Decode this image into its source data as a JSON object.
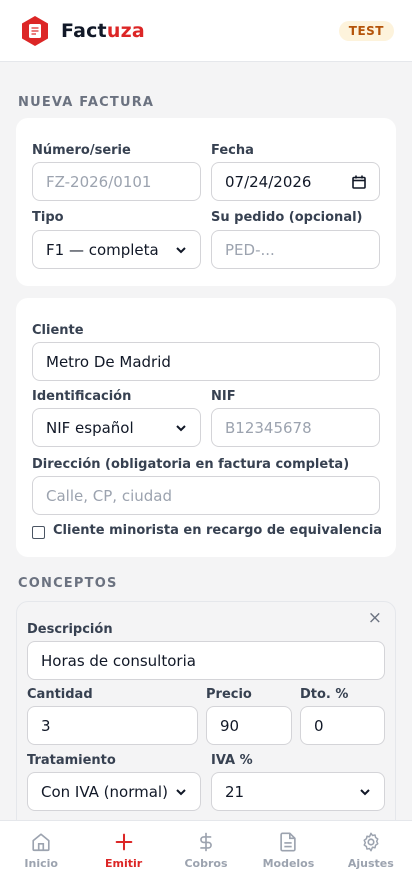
{
  "app": {
    "brand_part1": "Fact",
    "brand_part2": "uza",
    "env_badge": "TEST"
  },
  "colors": {
    "accent": "#dc2626",
    "badge_bg": "#fdf3dc",
    "badge_text": "#b45309"
  },
  "section_invoice": {
    "title": "NUEVA FACTURA"
  },
  "invoice": {
    "number_label": "Número/serie",
    "number_placeholder": "FZ-2026/0101",
    "date_label": "Fecha",
    "date_value": "07/24/2026",
    "type_label": "Tipo",
    "type_value": "F1 — completa",
    "order_label": "Su pedido (opcional)",
    "order_placeholder": "PED-..."
  },
  "client": {
    "client_label": "Cliente",
    "client_value": "Metro De Madrid",
    "id_label": "Identificación",
    "id_value": "NIF español",
    "nif_label": "NIF",
    "nif_placeholder": "B12345678",
    "address_label": "Dirección (obligatoria en factura completa)",
    "address_placeholder": "Calle, CP, ciudad",
    "retail_checkbox_label": "Cliente minorista en recargo de equivalencia",
    "retail_checked": false
  },
  "section_concepts": {
    "title": "CONCEPTOS"
  },
  "concept": {
    "description_label": "Descripción",
    "description_value": "Horas de consultoria",
    "quantity_label": "Cantidad",
    "quantity_value": "3",
    "price_label": "Precio",
    "price_value": "90",
    "discount_label": "Dto. %",
    "discount_value": "0",
    "treatment_label": "Tratamiento",
    "treatment_value": "Con IVA (normal)",
    "vat_label": "IVA %",
    "vat_value": "21",
    "remove_glyph": "×"
  },
  "tabs": [
    {
      "label": "Inicio",
      "icon": "home-icon"
    },
    {
      "label": "Emitir",
      "icon": "plus-icon",
      "active": true
    },
    {
      "label": "Cobros",
      "icon": "dollar-icon"
    },
    {
      "label": "Modelos",
      "icon": "document-icon"
    },
    {
      "label": "Ajustes",
      "icon": "gear-icon"
    }
  ]
}
